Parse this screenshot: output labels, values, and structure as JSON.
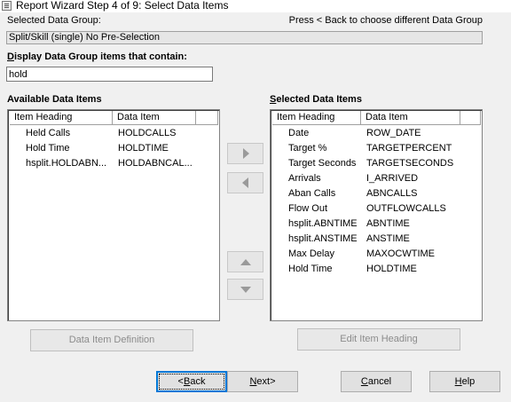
{
  "window": {
    "title": "Report Wizard Step 4 of 9: Select Data Items"
  },
  "header": {
    "selected_group_label": "Selected Data Group:",
    "hint": "Press < Back to choose different Data Group",
    "selected_group_value": "Split/Skill (single) No Pre-Selection"
  },
  "filter": {
    "label_pre": "D",
    "label_rest": "isplay Data Group items that contain:",
    "value": "hold"
  },
  "available": {
    "title": "Available Data Items",
    "columns": [
      "Item Heading",
      "Data Item"
    ],
    "rows": [
      {
        "heading": "Held Calls",
        "item": "HOLDCALLS"
      },
      {
        "heading": "Hold Time",
        "item": "HOLDTIME"
      },
      {
        "heading": "hsplit.HOLDABN...",
        "item": "HOLDABNCAL..."
      }
    ]
  },
  "selected": {
    "title_pre": "S",
    "title_rest": "elected Data Items",
    "columns": [
      "Item Heading",
      "Data Item"
    ],
    "rows": [
      {
        "heading": "Date",
        "item": "ROW_DATE"
      },
      {
        "heading": "Target %",
        "item": "TARGETPERCENT"
      },
      {
        "heading": "Target Seconds",
        "item": "TARGETSECONDS"
      },
      {
        "heading": "Arrivals",
        "item": "I_ARRIVED"
      },
      {
        "heading": "Aban Calls",
        "item": "ABNCALLS"
      },
      {
        "heading": "Flow Out",
        "item": "OUTFLOWCALLS"
      },
      {
        "heading": "hsplit.ABNTIME",
        "item": "ABNTIME"
      },
      {
        "heading": "hsplit.ANSTIME",
        "item": "ANSTIME"
      },
      {
        "heading": "Max Delay",
        "item": "MAXOCWTIME"
      },
      {
        "heading": "Hold Time",
        "item": "HOLDTIME"
      }
    ]
  },
  "buttons": {
    "data_item_definition": "Data Item Definition",
    "edit_item_heading": "Edit Item Heading",
    "back_pre": "<",
    "back_u": "B",
    "back_rest": "ack",
    "next_u": "N",
    "next_rest": "ext>",
    "cancel_u": "C",
    "cancel_rest": "ancel",
    "help_u": "H",
    "help_rest": "elp"
  },
  "icons": {
    "add": "right-arrow-icon",
    "remove": "left-arrow-icon",
    "move_up": "up-arrow-icon",
    "move_down": "down-arrow-icon"
  }
}
